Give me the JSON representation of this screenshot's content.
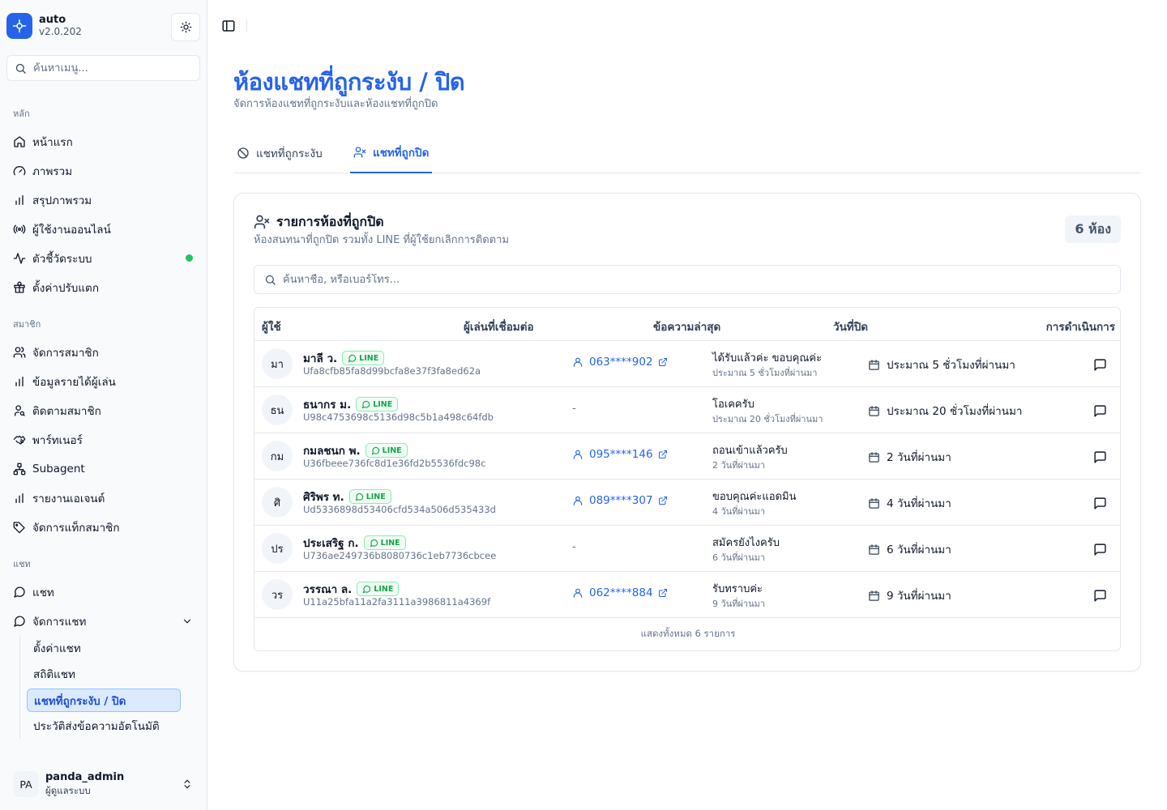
{
  "app": {
    "name": "auto",
    "version": "v2.0.202"
  },
  "sidebar": {
    "search_placeholder": "ค้นหาเมนู...",
    "groups": {
      "main": "หลัก",
      "members": "สมาชิก",
      "chat": "แชท"
    },
    "main_items": [
      {
        "label": "หน้าแรก",
        "icon": "home-icon"
      },
      {
        "label": "ภาพรวม",
        "icon": "gauge-icon"
      },
      {
        "label": "สรุปภาพรวม",
        "icon": "bar-chart-icon"
      },
      {
        "label": "ผู้ใช้งานออนไลน์",
        "icon": "radio-icon"
      },
      {
        "label": "ตัวชี้วัดระบบ",
        "icon": "activity-icon",
        "status_color": "#22c55e"
      },
      {
        "label": "ตั้งค่าปรับแตก",
        "icon": "gift-icon"
      }
    ],
    "member_items": [
      {
        "label": "จัดการสมาชิก",
        "icon": "users-icon"
      },
      {
        "label": "ข้อมูลรายได้ผู้เล่น",
        "icon": "bar-chart-icon"
      },
      {
        "label": "ติดตามสมาชิก",
        "icon": "user-search-icon"
      },
      {
        "label": "พาร์ทเนอร์",
        "icon": "handshake-icon"
      },
      {
        "label": "Subagent",
        "icon": "network-icon"
      },
      {
        "label": "รายงานเอเจนต์",
        "icon": "bar-chart-icon"
      },
      {
        "label": "จัดการแท็กสมาชิก",
        "icon": "tag-icon"
      }
    ],
    "chat_items": [
      {
        "label": "แชท",
        "icon": "message-circle-icon"
      },
      {
        "label": "จัดการแชท",
        "icon": "message-circle-icon"
      }
    ],
    "chat_sub_items": [
      {
        "label": "ตั้งค่าแชท"
      },
      {
        "label": "สถิติแชท"
      },
      {
        "label": "แชทที่ถูกระงับ / ปิด"
      },
      {
        "label": "ประวัติส่งข้อความอัตโนมัติ"
      }
    ],
    "user": {
      "initials": "PA",
      "name": "panda_admin",
      "role": "ผู้ดูแลระบบ"
    }
  },
  "page": {
    "title": "ห้องแชทที่ถูกระงับ / ปิด",
    "subtitle": "จัดการห้องแชทที่ถูกระงับและห้องแชทที่ถูกปิด",
    "tabs": [
      {
        "label": "แชทที่ถูกระงับ",
        "icon": "ban-icon"
      },
      {
        "label": "แชทที่ถูกปิด",
        "icon": "user-x-icon"
      }
    ]
  },
  "card": {
    "title": "รายการห้องที่ถูกปิด",
    "description": "ห้องสนทนาที่ถูกปิด รวมทั้ง LINE ที่ผู้ใช้ยกเลิกการติดตาม",
    "count": "6 ห้อง",
    "search_placeholder": "ค้นหาชื่อ, หรือเบอร์โทร...",
    "columns": [
      "ผู้ใช้",
      "ผู้เล่นที่เชื่อมต่อ",
      "ข้อความล่าสุด",
      "วันที่ปิด",
      "การดำเนินการ"
    ],
    "line_label": "LINE",
    "rows": [
      {
        "initials": "มา",
        "name": "มาลี ว.",
        "uid": "Ufa8cfb85fa8d99bcfa8e37f3fa8ed62a",
        "player": "063****902",
        "message": "ได้รับแล้วค่ะ ขอบคุณค่ะ",
        "message_time": "ประมาณ 5 ชั่วโมงที่ผ่านมา",
        "closed": "ประมาณ 5 ชั่วโมงที่ผ่านมา"
      },
      {
        "initials": "ธน",
        "name": "ธนากร ม.",
        "uid": "U98c4753698c5136d98c5b1a498c64fdb",
        "player": "-",
        "message": "โอเคครับ",
        "message_time": "ประมาณ 20 ชั่วโมงที่ผ่านมา",
        "closed": "ประมาณ 20 ชั่วโมงที่ผ่านมา"
      },
      {
        "initials": "กม",
        "name": "กมลชนก พ.",
        "uid": "U36fbeee736fc8d1e36fd2b5536fdc98c",
        "player": "095****146",
        "message": "ถอนเข้าแล้วครับ",
        "message_time": "2 วันที่ผ่านมา",
        "closed": "2 วันที่ผ่านมา"
      },
      {
        "initials": "ศิ",
        "name": "ศิริพร ท.",
        "uid": "Ud5336898d53406cfd534a506d535433d",
        "player": "089****307",
        "message": "ขอบคุณค่ะแอดมิน",
        "message_time": "4 วันที่ผ่านมา",
        "closed": "4 วันที่ผ่านมา"
      },
      {
        "initials": "ปร",
        "name": "ประเสริฐ ก.",
        "uid": "U736ae249736b8080736c1eb7736cbcee",
        "player": "-",
        "message": "สมัครยังไงครับ",
        "message_time": "6 วันที่ผ่านมา",
        "closed": "6 วันที่ผ่านมา"
      },
      {
        "initials": "วร",
        "name": "วรรณา ล.",
        "uid": "U11a25bfa11a2fa3111a3986811a4369f",
        "player": "062****884",
        "message": "รับทราบค่ะ",
        "message_time": "9 วันที่ผ่านมา",
        "closed": "9 วันที่ผ่านมา"
      }
    ],
    "footer": "แสดงทั้งหมด 6 รายการ"
  },
  "colors": {
    "accent": "#2563eb",
    "line_green": "#16a34a",
    "status_online": "#22c55e"
  }
}
